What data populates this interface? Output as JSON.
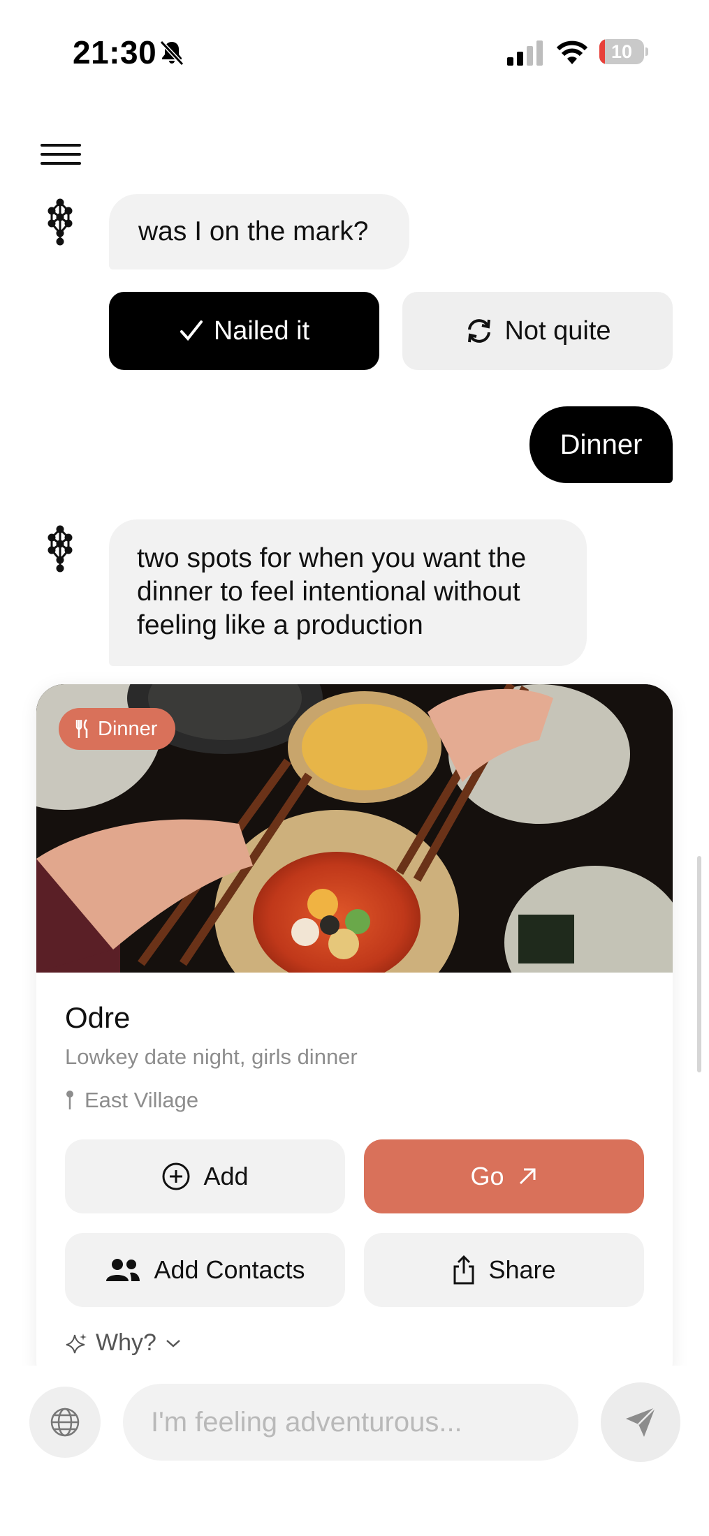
{
  "status_bar": {
    "time": "21:30",
    "battery": "10",
    "icons": [
      "bell-slash-icon",
      "signal-icon",
      "wifi-icon",
      "battery-icon"
    ]
  },
  "header": {
    "menu_icon": "hamburger-menu-icon"
  },
  "chat": {
    "bot_question": "was I on the mark?",
    "feedback": {
      "yes_label": "Nailed it",
      "no_label": "Not quite"
    },
    "user_reply": "Dinner",
    "bot_answer": [
      "two spots for when you want the",
      "dinner to feel intentional without",
      "feeling like a production"
    ]
  },
  "card": {
    "tag": "Dinner",
    "name": "Odre",
    "description": "Lowkey date night, girls dinner",
    "location": "East Village",
    "actions": {
      "add": "Add",
      "go": "Go",
      "add_contacts": "Add Contacts",
      "share": "Share"
    },
    "why": "Why?"
  },
  "composer": {
    "placeholder": "I'm feeling adventurous..."
  },
  "colors": {
    "accent": "#d9715a",
    "bubble": "#f2f2f2",
    "dark": "#000000"
  }
}
